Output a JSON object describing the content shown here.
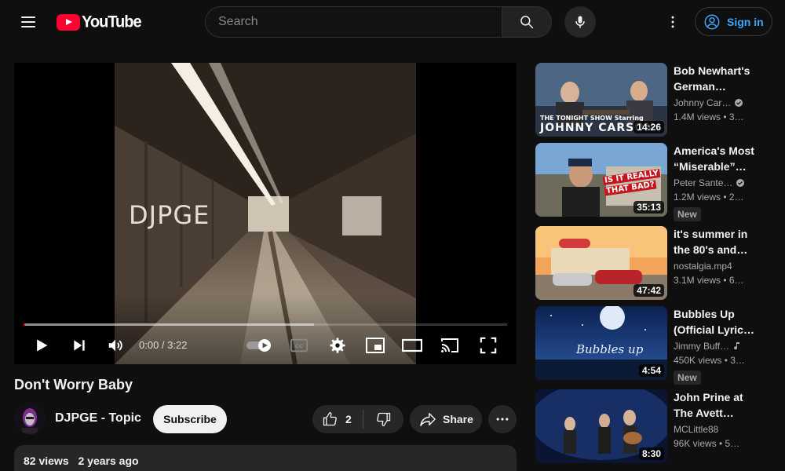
{
  "header": {
    "logo_text": "YouTube",
    "search_placeholder": "Search",
    "sign_in_label": "Sign in"
  },
  "player": {
    "video_overlay_text": "DJPGE",
    "current_time": "0:00",
    "duration": "3:22",
    "time_display": "0:00 / 3:22",
    "played_fraction": 0.0,
    "loaded_fraction": 0.6
  },
  "video": {
    "title": "Don't Worry Baby",
    "channel_name": "DJPGE - Topic",
    "subscribe_label": "Subscribe",
    "like_count": "2",
    "share_label": "Share",
    "views": "82 views",
    "published": "2 years ago"
  },
  "recommendations": [
    {
      "title": "Bob Newhart's German…",
      "channel": "Johnny Car…",
      "verified": true,
      "music": false,
      "meta": "1.4M views • 3…",
      "duration": "14:26",
      "badge": "",
      "thumb_overlay_line1": "THE TONIGHT SHOW Starring",
      "thumb_overlay_line2": "JOHNNY CARSON"
    },
    {
      "title": "America's Most “Miserable”…",
      "channel": "Peter Sante…",
      "verified": true,
      "music": false,
      "meta": "1.2M views • 2…",
      "duration": "35:13",
      "badge": "New",
      "thumb_overlay_line1": "IS IT REALLY",
      "thumb_overlay_line2": "THAT BAD?"
    },
    {
      "title": "it's summer in the 80's and…",
      "channel": "nostalgia.mp4",
      "verified": false,
      "music": false,
      "meta": "3.1M views • 6…",
      "duration": "47:42",
      "badge": ""
    },
    {
      "title": "Bubbles Up (Official Lyric…",
      "channel": "Jimmy Buff…",
      "verified": false,
      "music": true,
      "meta": "450K views • 3…",
      "duration": "4:54",
      "badge": "New",
      "thumb_overlay_line1": "Bubbles up"
    },
    {
      "title": "John Prine at The Avett…",
      "channel": "MCLittle88",
      "verified": false,
      "music": false,
      "meta": "96K views • 5…",
      "duration": "8:30",
      "badge": ""
    }
  ],
  "colors": {
    "background": "#0f0f0f",
    "brand_red": "#ff0033",
    "progress_red": "#ff0000",
    "link_blue": "#3ea6ff",
    "chip_bg": "#272727"
  },
  "icons": {
    "menu": "hamburger-menu-icon",
    "search": "search-icon",
    "mic": "microphone-icon",
    "more": "vertical-dots-icon",
    "account": "account-circle-icon",
    "play": "play-icon",
    "next": "skip-next-icon",
    "volume": "volume-icon",
    "autoplay": "autoplay-toggle-icon",
    "cc": "closed-captions-icon",
    "settings": "gear-icon",
    "miniplayer": "miniplayer-icon",
    "theater": "theater-mode-icon",
    "cast": "cast-icon",
    "fullscreen": "fullscreen-icon",
    "like": "thumbs-up-icon",
    "dislike": "thumbs-down-icon",
    "share": "share-arrow-icon",
    "verified": "verified-check-icon",
    "music": "music-note-icon"
  }
}
